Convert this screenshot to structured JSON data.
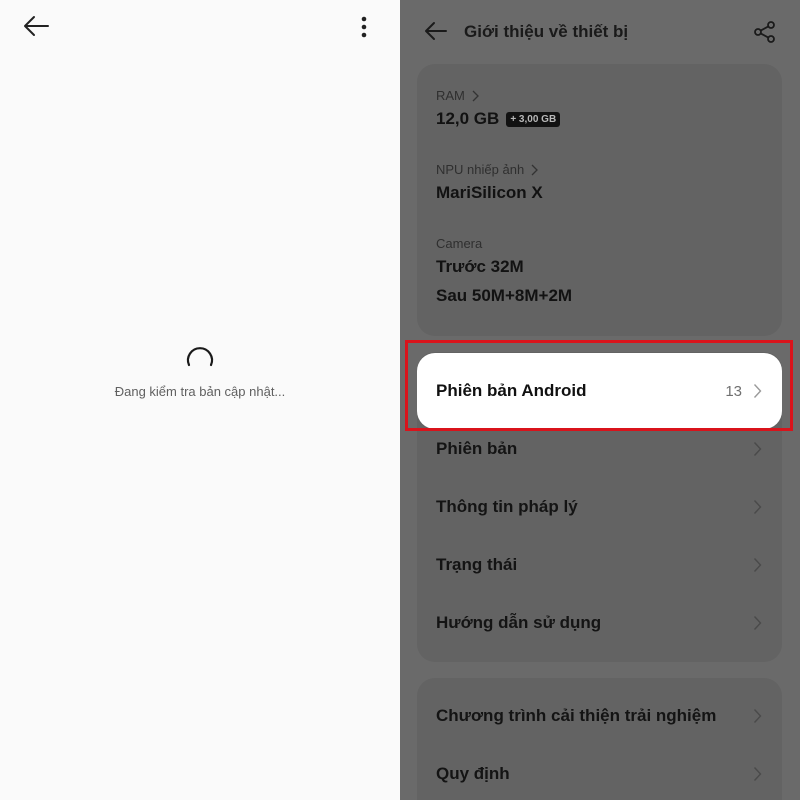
{
  "left_panel": {
    "loading_text": "Đang kiểm tra bản cập nhật..."
  },
  "right_panel": {
    "header": {
      "title": "Giới thiệu về thiết bị"
    },
    "specs": [
      {
        "label": "RAM",
        "value": "12,0 GB",
        "badge": "+ 3,00 GB",
        "has_chevron": true
      },
      {
        "label": "NPU nhiếp ảnh",
        "value": "MariSilicon X",
        "has_chevron": true
      },
      {
        "label": "Camera",
        "value": "Trước 32M",
        "value2": "Sau 50M+8M+2M",
        "has_chevron": false
      }
    ],
    "android_version": {
      "label": "Phiên bản Android",
      "value": "13"
    },
    "list_items": [
      {
        "label": "Phiên bản"
      },
      {
        "label": "Thông tin pháp lý"
      },
      {
        "label": "Trạng thái"
      },
      {
        "label": "Hướng dẫn sử dụng"
      }
    ],
    "list_items2": [
      {
        "label": "Chương trình cải thiện trải nghiệm"
      },
      {
        "label": "Quy định"
      }
    ]
  },
  "colors": {
    "highlight_border": "#d9131b",
    "overlay_gray": "#6a6a6a"
  }
}
